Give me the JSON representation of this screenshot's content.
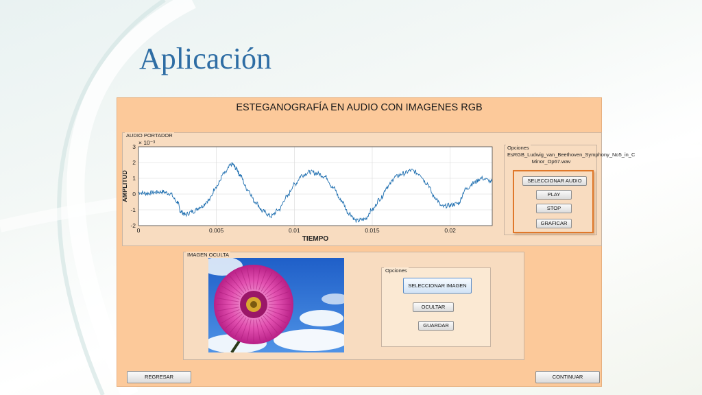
{
  "slide": {
    "title": "Aplicación"
  },
  "app": {
    "title": "ESTEGANOGRAFÍA EN AUDIO CON IMAGENES RGB",
    "audio_panel": {
      "label": "AUDIO PORTADOR",
      "options": {
        "label": "Opciones",
        "file_name": "EsRGB_Ludwig_van_Beethoven_Symphony_No5_in_C Minor_Op67.wav",
        "buttons": [
          "SELECCIONAR AUDIO",
          "PLAY",
          "STOP",
          "GRAFICAR"
        ]
      }
    },
    "image_panel": {
      "label": "IMAGEN OCULTA",
      "options": {
        "label": "Opciones",
        "buttons": [
          "SELECCIONAR IMAGEN",
          "OCULTAR",
          "GUARDAR"
        ]
      }
    },
    "footer": {
      "back": "REGRESAR",
      "continue": "CONTINUAR"
    }
  },
  "chart_data": {
    "type": "line",
    "xlabel": "TIEMPO",
    "ylabel": "AMPLITUD",
    "y_exponent": "× 10⁻³",
    "xlim": [
      0,
      0.0227
    ],
    "ylim": [
      -2,
      3
    ],
    "x_ticks": [
      0,
      0.005,
      0.01,
      0.015,
      0.02
    ],
    "x_tick_labels": [
      "0",
      "0.005",
      "0.01",
      "0.015",
      "0.02"
    ],
    "y_ticks": [
      -2,
      -1,
      0,
      1,
      2,
      3
    ],
    "y_tick_labels": [
      "-2",
      "-1",
      "0",
      "1",
      "2",
      "3"
    ],
    "grid": true,
    "line_color": "#1f6fb0",
    "series": [
      {
        "x": [
          0,
          0.0005,
          0.001,
          0.0015,
          0.002,
          0.0025,
          0.0027,
          0.003,
          0.0035,
          0.004,
          0.0045,
          0.005,
          0.0055,
          0.006,
          0.0063,
          0.0065,
          0.007,
          0.0075,
          0.008,
          0.0085,
          0.009,
          0.0095,
          0.01,
          0.0105,
          0.011,
          0.0115,
          0.012,
          0.0125,
          0.013,
          0.0135,
          0.014,
          0.0145,
          0.015,
          0.0155,
          0.016,
          0.0165,
          0.017,
          0.0175,
          0.018,
          0.0185,
          0.019,
          0.0195,
          0.02,
          0.0205,
          0.021,
          0.0215,
          0.022,
          0.0227
        ],
        "y": [
          0.1,
          0.05,
          0.1,
          0.15,
          0.05,
          -0.5,
          -1.1,
          -1.3,
          -1.1,
          -0.8,
          -0.4,
          0.5,
          1.3,
          1.9,
          1.6,
          1.2,
          0.3,
          -0.5,
          -1.1,
          -1.4,
          -1.0,
          -0.2,
          0.6,
          1.2,
          1.4,
          1.3,
          1.1,
          0.4,
          -0.4,
          -1.2,
          -1.7,
          -1.6,
          -1.0,
          -0.3,
          0.5,
          1.1,
          1.3,
          1.5,
          1.3,
          0.7,
          -0.2,
          -0.8,
          -0.7,
          -0.6,
          0.3,
          0.7,
          1.0,
          0.8
        ]
      }
    ]
  }
}
